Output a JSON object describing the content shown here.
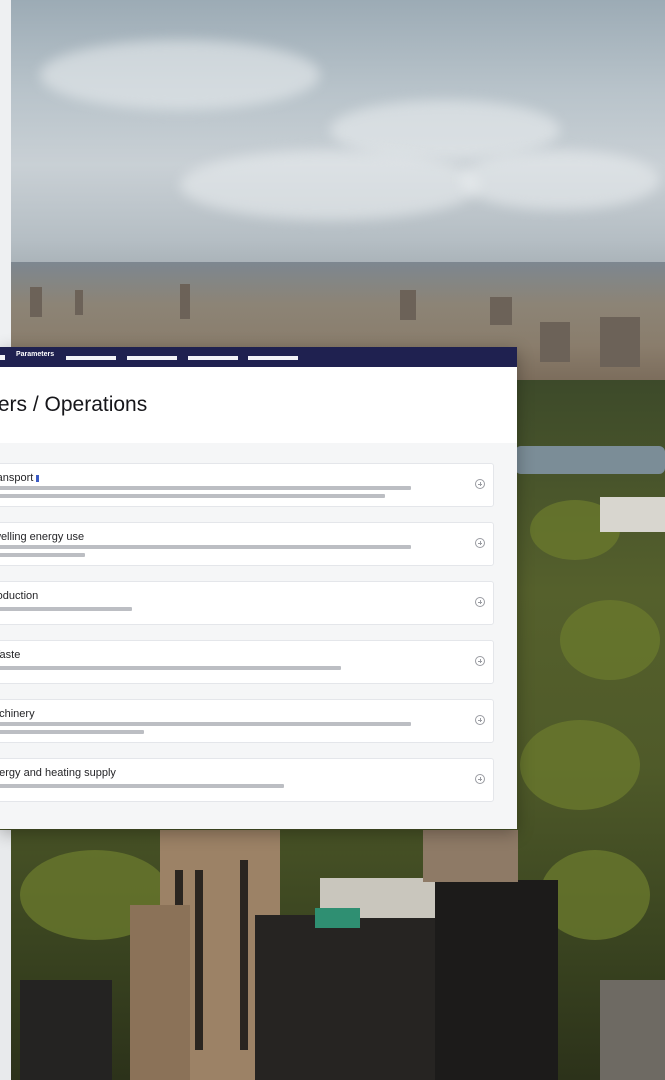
{
  "app": {
    "active_tab_label": "Parameters",
    "inactive_tab_count": 4
  },
  "page": {
    "title": "ters / Operations"
  },
  "items": [
    {
      "label": "ransport"
    },
    {
      "label": "welling energy use"
    },
    {
      "label": "roduction"
    },
    {
      "label": "Vaste"
    },
    {
      "label": "achinery"
    },
    {
      "label": "nergy and heating supply"
    }
  ],
  "icons": {
    "item_action": "add-circle-icon"
  },
  "colors": {
    "topbar": "#1f2150",
    "placeholder_bar": "#bcbec3",
    "panel_bg": "#f5f6f7"
  }
}
